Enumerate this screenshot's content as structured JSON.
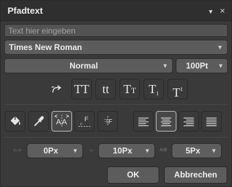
{
  "dialog": {
    "title": "Pfadtext",
    "menu_icon": "chevron-down-icon",
    "close_icon": "close-icon",
    "close_glyph": "×",
    "menu_glyph": "▼"
  },
  "text_input": {
    "placeholder": "Text hier eingeben",
    "value": ""
  },
  "font": {
    "selected": "Times New Roman"
  },
  "weight": {
    "selected": "Normal"
  },
  "size": {
    "selected": "100Pt"
  },
  "case_buttons": [
    {
      "name": "reset-case",
      "glyph": "⤴"
    },
    {
      "name": "all-caps",
      "glyph": "TT"
    },
    {
      "name": "lowercase",
      "glyph": "tt"
    },
    {
      "name": "small-caps",
      "glyph": "TT"
    },
    {
      "name": "subscript",
      "glyph": "T₁"
    },
    {
      "name": "superscript",
      "glyph": "T¹"
    }
  ],
  "offsets": {
    "horizontal": "0Px",
    "vertical": "10Px",
    "spacing": "5Px"
  },
  "buttons": {
    "ok": "OK",
    "cancel": "Abbrechen"
  },
  "colors": {
    "background": "#3a3a3a",
    "titlebar": "#2f2f2f",
    "field": "#5c5c5c",
    "text": "#ececec"
  }
}
